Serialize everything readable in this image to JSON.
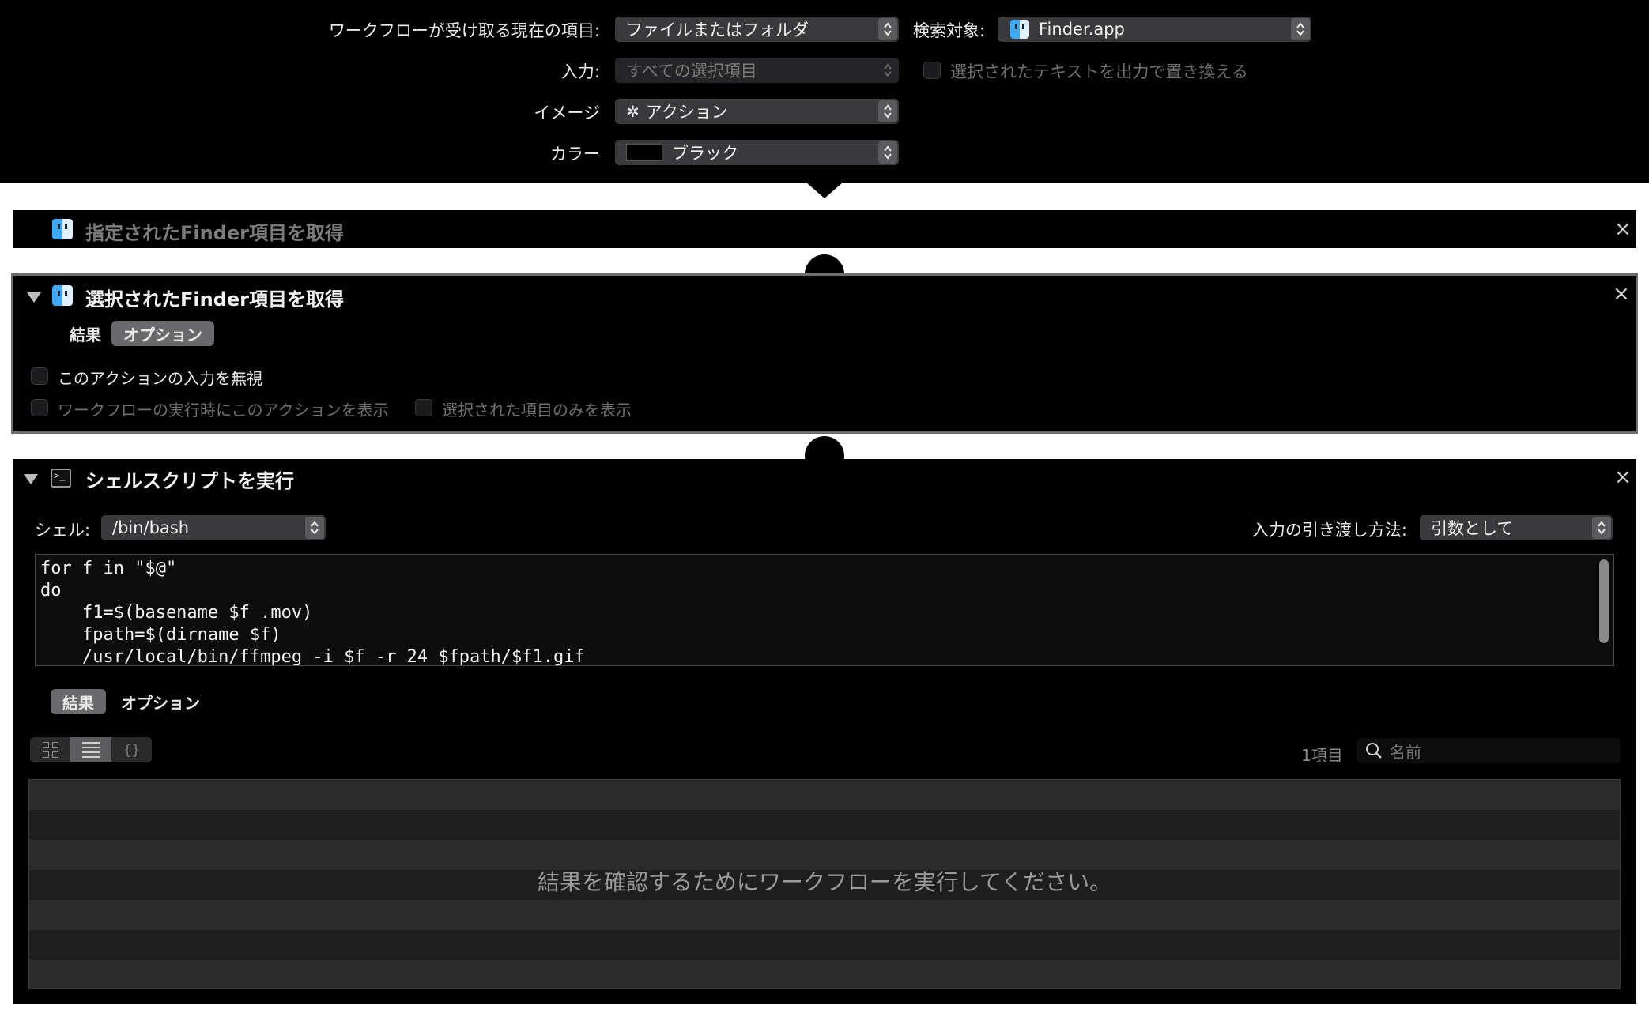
{
  "header": {
    "workflow_receives_label": "ワークフローが受け取る現在の項目:",
    "workflow_receives_value": "ファイルまたはフォルダ",
    "search_target_label": "検索対象:",
    "search_target_value": "Finder.app",
    "input_label": "入力:",
    "input_value": "すべての選択項目",
    "replace_text_label": "選択されたテキストを出力で置き換える",
    "image_label": "イメージ",
    "image_value": "アクション",
    "image_icon": "gear-icon",
    "color_label": "カラー",
    "color_value": "ブラック",
    "color_swatch": "#000000"
  },
  "action1": {
    "title": "指定されたFinder項目を取得",
    "icon": "finder-icon"
  },
  "action2": {
    "title": "選択されたFinder項目を取得",
    "icon": "finder-icon",
    "tab_results": "結果",
    "tab_options": "オプション",
    "ignore_input_label": "このアクションの入力を無視",
    "show_when_run_label": "ワークフローの実行時にこのアクションを表示",
    "show_selected_only_label": "選択された項目のみを表示"
  },
  "action3": {
    "title": "シェルスクリプトを実行",
    "icon": "terminal-icon",
    "shell_label": "シェル:",
    "shell_value": "/bin/bash",
    "pass_input_label": "入力の引き渡し方法:",
    "pass_input_value": "引数として",
    "script": "for f in \"$@\"\ndo\n    f1=$(basename $f .mov)\n    fpath=$(dirname $f)\n    /usr/local/bin/ffmpeg -i $f -r 24 $fpath/$f1.gif",
    "tab_results": "結果",
    "tab_options": "オプション",
    "item_count": "1項目",
    "search_placeholder": "名前",
    "view_json_label": "{}",
    "empty_message": "結果を確認するためにワークフローを実行してください。"
  },
  "colors": {
    "background": "#000000",
    "panel_border": "#6e6e6e",
    "popup_bg": "#3a3a3c",
    "selected_segment": "#6a6a6c"
  }
}
